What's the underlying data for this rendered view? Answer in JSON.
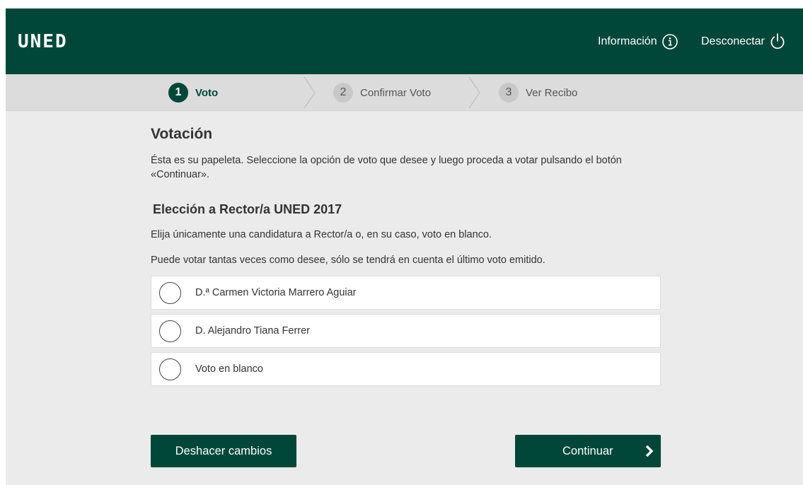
{
  "header": {
    "logo": "UNED",
    "info_label": "Información",
    "logout_label": "Desconectar",
    "brand_color": "#00473a"
  },
  "steps": [
    {
      "number": "1",
      "label": "Voto",
      "active": true
    },
    {
      "number": "2",
      "label": "Confirmar Voto",
      "active": false
    },
    {
      "number": "3",
      "label": "Ver Recibo",
      "active": false
    }
  ],
  "main": {
    "title": "Votación",
    "intro": "Ésta es su papeleta. Seleccione la opción de voto que desee y luego proceda a votar pulsando el botón «Continuar».",
    "election_title": "Elección a Rector/a UNED 2017",
    "instruction_1": "Elija únicamente una candidatura a Rector/a o, en su caso, voto en blanco.",
    "instruction_2": "Puede votar tantas veces como desee, sólo se tendrá en cuenta el último voto emitido."
  },
  "options": [
    {
      "label": "D.ª Carmen Victoria Marrero Aguiar",
      "selected": false
    },
    {
      "label": "D. Alejandro Tiana Ferrer",
      "selected": false
    },
    {
      "label": "Voto en blanco",
      "selected": false
    }
  ],
  "buttons": {
    "undo_label": "Deshacer cambios",
    "continue_label": "Continuar"
  },
  "icons": {
    "info": "info-circle-icon",
    "logout": "power-icon",
    "continue": "chevron-right-icon"
  }
}
